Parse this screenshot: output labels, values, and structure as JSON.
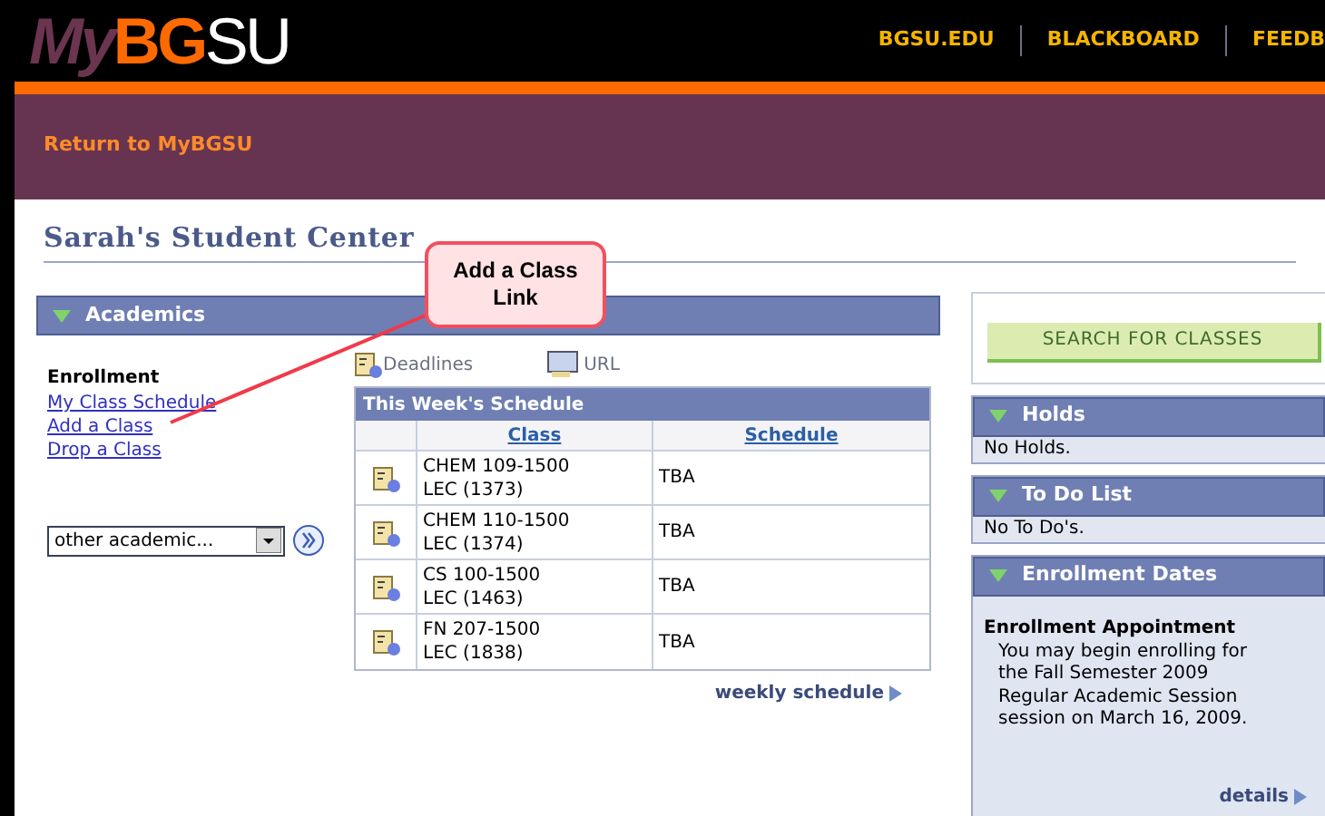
{
  "header": {
    "logo": {
      "my": "My",
      "bg": "BG",
      "su": "SU"
    },
    "nav_links": [
      "BGSU.EDU",
      "BLACKBOARD",
      "FEEDB"
    ],
    "return_link": "Return to MyBGSU"
  },
  "page_title": "Sarah's Student Center",
  "callout": "Add a Class Link",
  "academics": {
    "title": "Academics",
    "enrollment_heading": "Enrollment",
    "links": [
      "My Class Schedule",
      "Add a Class",
      "Drop a Class"
    ],
    "dropdown": {
      "value": "other academic..."
    },
    "shortcuts": [
      "Deadlines",
      "URL"
    ],
    "schedule": {
      "title": "This Week's Schedule",
      "columns": [
        "Class",
        "Schedule"
      ],
      "rows": [
        {
          "class_line1": "CHEM 109-1500",
          "class_line2": "LEC (1373)",
          "schedule": "TBA"
        },
        {
          "class_line1": "CHEM 110-1500",
          "class_line2": "LEC (1374)",
          "schedule": "TBA"
        },
        {
          "class_line1": "CS 100-1500",
          "class_line2": "LEC (1463)",
          "schedule": "TBA"
        },
        {
          "class_line1": "FN 207-1500",
          "class_line2": "LEC (1838)",
          "schedule": "TBA"
        }
      ],
      "footer_link": "weekly schedule"
    }
  },
  "search_button": "SEARCH FOR CLASSES",
  "side_panels": [
    {
      "title": "Holds",
      "body": "No Holds."
    },
    {
      "title": "To Do List",
      "body": "No To Do's."
    }
  ],
  "enrollment_dates": {
    "title": "Enrollment Dates",
    "heading": "Enrollment Appointment",
    "text": "You may begin enrolling for the Fall Semester 2009 Regular Academic Session session on March 16, 2009.",
    "details_link": "details"
  }
}
